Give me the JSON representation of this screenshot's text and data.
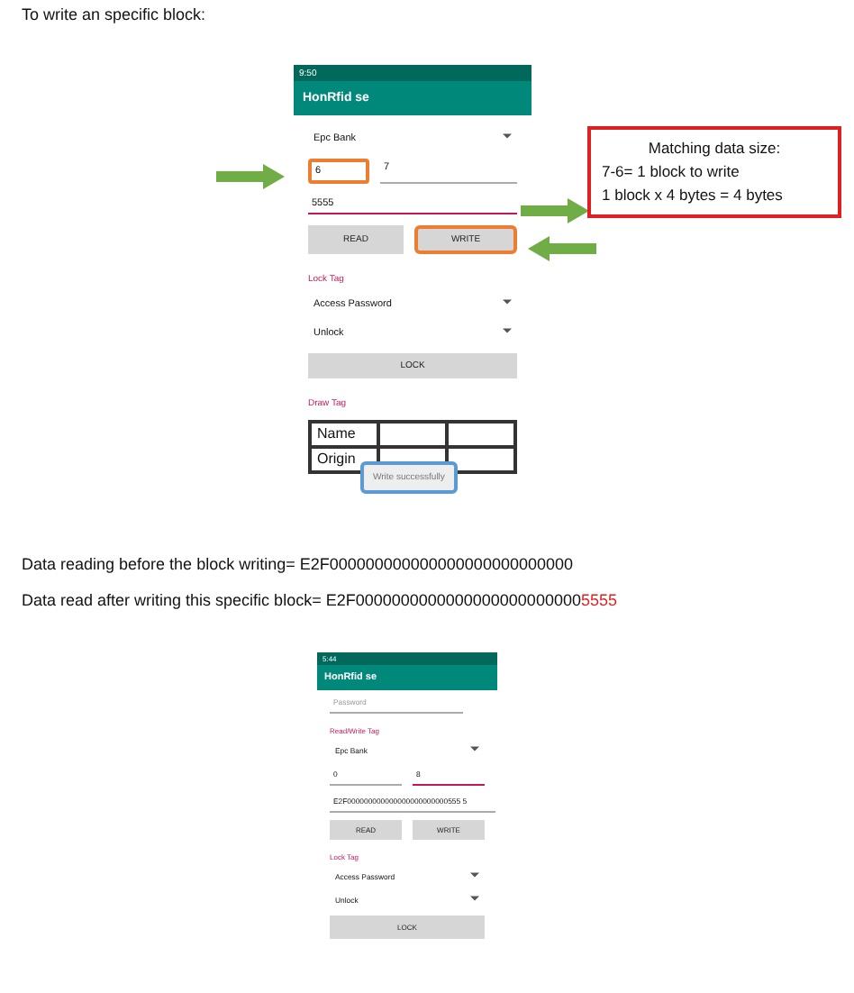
{
  "heading": "To write an specific block:",
  "phone_1": {
    "status_time": "9:50",
    "app_title": "HonRfid se",
    "bank_dropdown": "Epc Bank",
    "fields": [
      {
        "value": "6",
        "highlighted": true
      },
      {
        "value": "7",
        "highlighted": false
      }
    ],
    "data_field": "5555",
    "buttons": [
      {
        "label": "READ",
        "highlighted": false
      },
      {
        "label": "WRITE",
        "highlighted": true
      }
    ],
    "lock_section": "Lock Tag",
    "lock_dropdowns": [
      "Access Password",
      "Unlock"
    ],
    "lock_button": "LOCK",
    "draw_section": "Draw Tag",
    "table_rows": [
      "Name",
      "Origin"
    ],
    "toast": "Write successfully"
  },
  "callout": {
    "title": "Matching data size:",
    "lines": [
      "7-6= 1 block to write",
      "1 block x 4 bytes = 4 bytes"
    ]
  },
  "readings": [
    {
      "label": "Data reading before the block writing= ",
      "value": "E2F000000000000000000000000000"
    },
    {
      "label": "Data read after writing this specific block= ",
      "value": "E2F0000000000000000000000000",
      "changed": "5555"
    }
  ],
  "phone_2": {
    "status_time": "5:44",
    "app_title": "HonRfid se",
    "partial_field": "Password",
    "rw_section": "Read/Write Tag",
    "bank_dropdown": "Epc Bank",
    "fields": [
      "0",
      "8"
    ],
    "data_field": "E2F000000000000000000000000555 5",
    "buttons": [
      "READ",
      "WRITE"
    ],
    "lock_section": "Lock Tag",
    "lock_dropdowns": [
      "Access Password",
      "Unlock"
    ],
    "lock_button": "LOCK"
  }
}
